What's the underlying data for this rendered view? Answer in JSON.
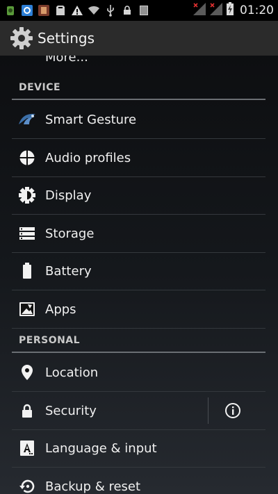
{
  "status_bar": {
    "time": "01:20",
    "icons": [
      "notification-app-icon",
      "notification-app-icon-2",
      "notification-app-icon-3",
      "sdcard-icon",
      "warning-icon",
      "wifi-icon",
      "usb-icon",
      "lock-icon",
      "barcode-icon",
      "signal-icon",
      "signal-icon-2",
      "battery-charging-icon"
    ]
  },
  "action_bar": {
    "title": "Settings",
    "icon": "gear-icon"
  },
  "partial_item": {
    "label": "More..."
  },
  "sections": [
    {
      "header": "DEVICE",
      "items": [
        {
          "label": "Smart Gesture",
          "icon": "smart-gesture-icon"
        },
        {
          "label": "Audio profiles",
          "icon": "audio-profiles-icon"
        },
        {
          "label": "Display",
          "icon": "brightness-icon"
        },
        {
          "label": "Storage",
          "icon": "storage-icon"
        },
        {
          "label": "Battery",
          "icon": "battery-icon"
        },
        {
          "label": "Apps",
          "icon": "apps-icon"
        }
      ]
    },
    {
      "header": "PERSONAL",
      "items": [
        {
          "label": "Location",
          "icon": "location-pin-icon"
        },
        {
          "label": "Security",
          "icon": "lock-icon",
          "secondary_icon": "info-icon"
        },
        {
          "label": "Language & input",
          "icon": "keyboard-letter-icon"
        },
        {
          "label": "Backup & reset",
          "icon": "backup-restore-icon"
        }
      ]
    }
  ]
}
